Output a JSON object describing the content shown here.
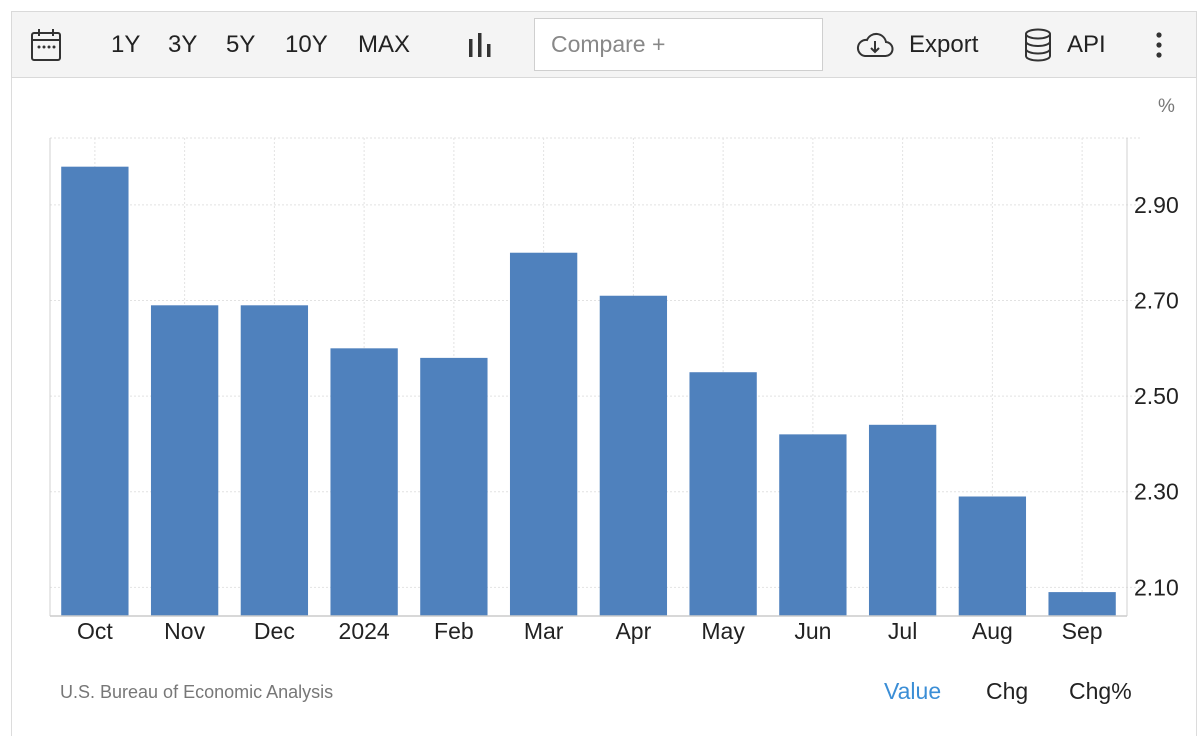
{
  "toolbar": {
    "calendar_icon": "calendar-icon",
    "ranges": [
      "1Y",
      "3Y",
      "5Y",
      "10Y",
      "MAX"
    ],
    "chart_type_icon": "bar-chart-icon",
    "compare_placeholder": "Compare +",
    "export_label": "Export",
    "export_icon": "cloud-download-icon",
    "api_label": "API",
    "api_icon": "database-icon",
    "more_icon": "vertical-dots-icon"
  },
  "footer": {
    "source": "U.S. Bureau of Economic Analysis",
    "tabs": [
      "Value",
      "Chg",
      "Chg%"
    ],
    "active_tab": "Value"
  },
  "chart_data": {
    "type": "bar",
    "categories": [
      "Oct",
      "Nov",
      "Dec",
      "2024",
      "Feb",
      "Mar",
      "Apr",
      "May",
      "Jun",
      "Jul",
      "Aug",
      "Sep"
    ],
    "values": [
      2.98,
      2.69,
      2.69,
      2.6,
      2.58,
      2.8,
      2.71,
      2.55,
      2.42,
      2.44,
      2.29,
      2.09
    ],
    "ylabel": "%",
    "y_ticks": [
      "2.10",
      "2.30",
      "2.50",
      "2.70",
      "2.90"
    ],
    "ylim": [
      2.04,
      3.04
    ],
    "bar_color": "#4f81bd",
    "grid": true,
    "y_axis_side": "right"
  }
}
